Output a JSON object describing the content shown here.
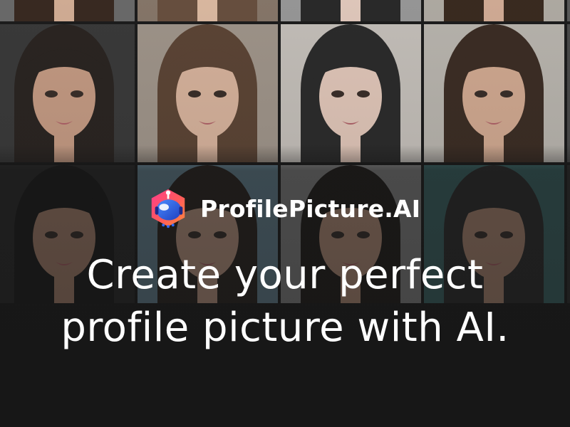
{
  "brand": {
    "name": "ProfilePicture.AI",
    "logo_icon": "robot-head-icon",
    "logo_colors": [
      "#ff3d8b",
      "#ff8a3d",
      "#2d6bff"
    ]
  },
  "headline": {
    "line1": "Create your perfect",
    "line2": "profile picture with AI."
  },
  "background": {
    "type": "portrait-grid",
    "portrait_count": 15,
    "text_color": "#ffffff"
  }
}
